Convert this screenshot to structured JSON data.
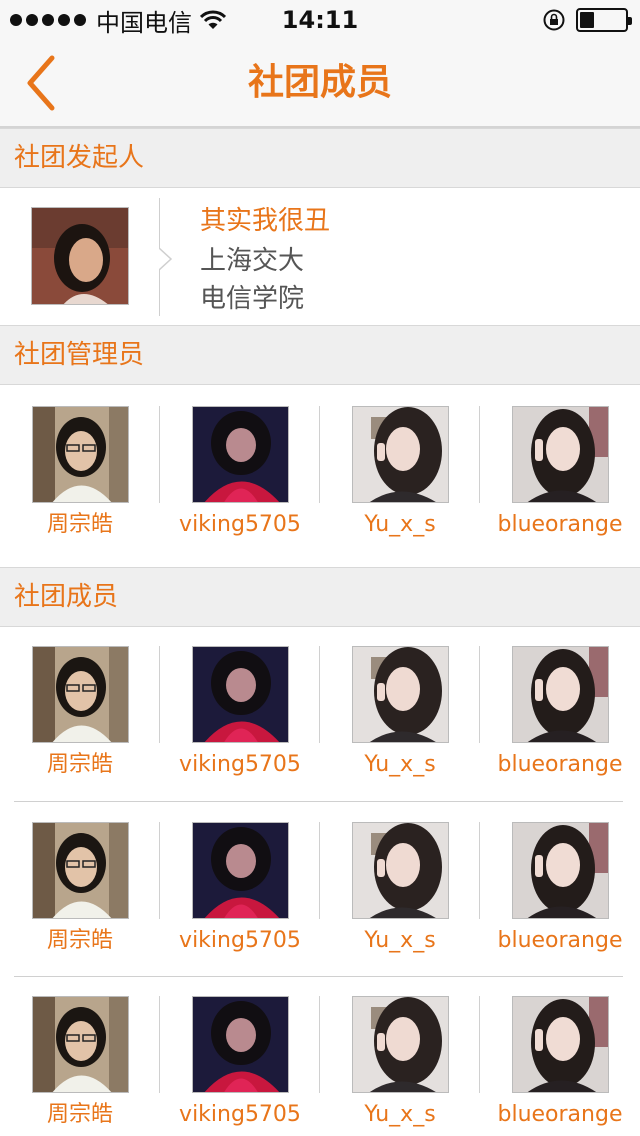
{
  "status_bar": {
    "carrier": "中国电信",
    "time": "14:11",
    "icons": [
      "signal-dots-icon",
      "wifi-icon",
      "rotation-lock-icon",
      "battery-icon"
    ]
  },
  "nav": {
    "title": "社团成员",
    "back_icon": "chevron-left-icon"
  },
  "colors": {
    "accent": "#e8751a",
    "section_bg": "#efefef",
    "text_gray": "#555555"
  },
  "sections": {
    "founder": {
      "title": "社团发起人",
      "name": "其实我很丑",
      "school": "上海交大",
      "college": "电信学院"
    },
    "admins": {
      "title": "社团管理员",
      "members": [
        "周宗皓",
        "viking5705",
        "Yu_x_s",
        "blueorange"
      ]
    },
    "members": {
      "title": "社团成员",
      "rows": [
        [
          "周宗皓",
          "viking5705",
          "Yu_x_s",
          "blueorange"
        ],
        [
          "周宗皓",
          "viking5705",
          "Yu_x_s",
          "blueorange"
        ],
        [
          "周宗皓",
          "viking5705",
          "Yu_x_s",
          "blueorange"
        ]
      ]
    }
  }
}
